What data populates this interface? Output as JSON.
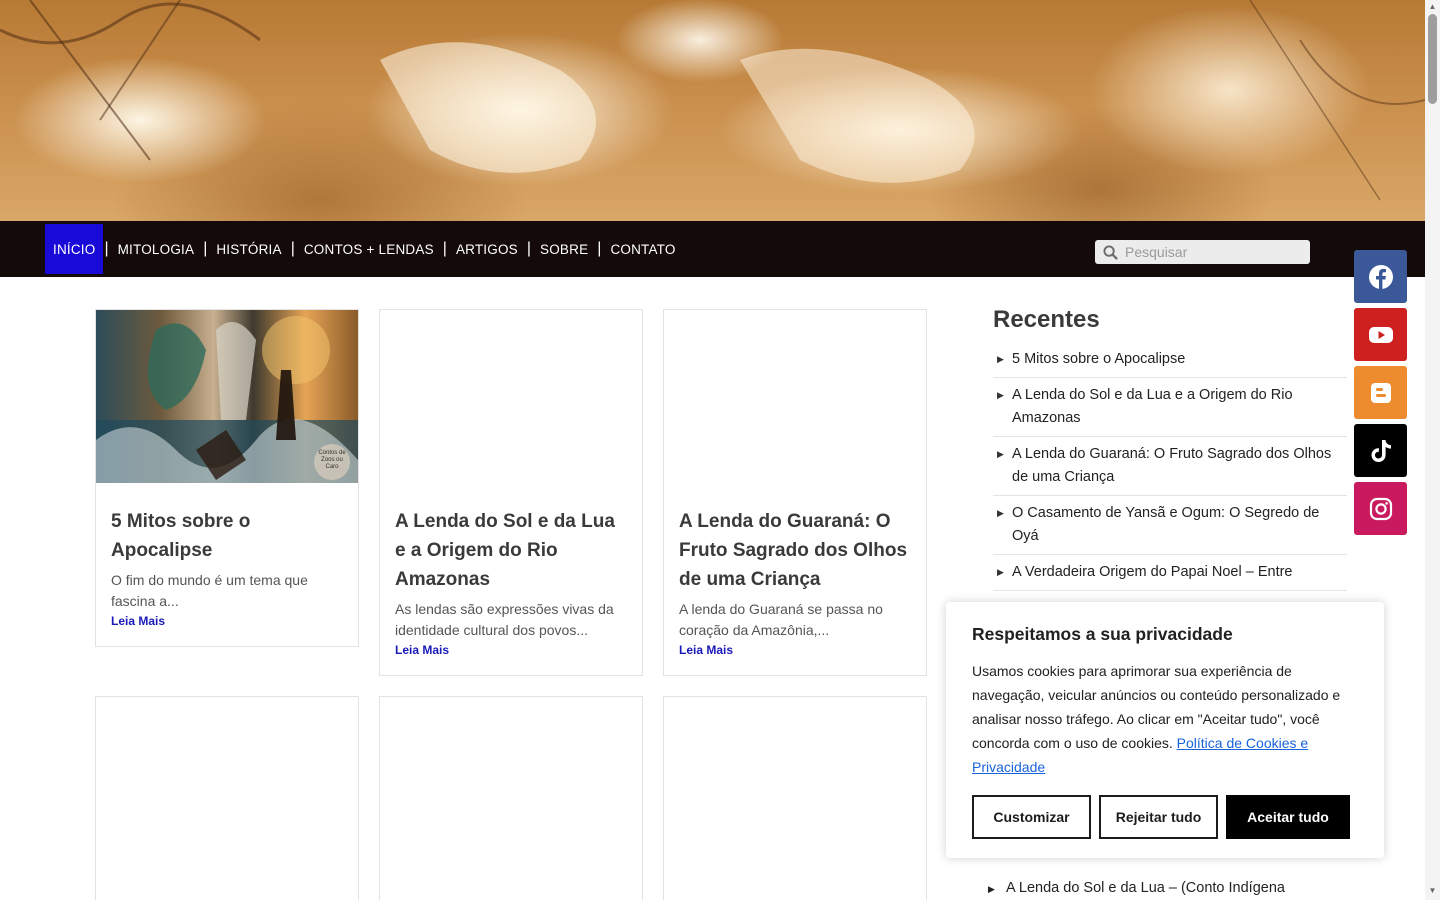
{
  "nav": {
    "items": [
      {
        "label": "INÍCIO",
        "active": true
      },
      {
        "label": "MITOLOGIA"
      },
      {
        "label": "HISTÓRIA"
      },
      {
        "label": "CONTOS + LENDAS"
      },
      {
        "label": "ARTIGOS"
      },
      {
        "label": "SOBRE"
      },
      {
        "label": "CONTATO"
      }
    ],
    "separator": "|"
  },
  "search": {
    "placeholder": "Pesquisar",
    "icon": "search-icon"
  },
  "posts": [
    {
      "title": "5 Mitos sobre o Apocalipse",
      "excerpt": "O fim do mundo é um tema que fascina a...",
      "more": "Leia Mais",
      "thumb_caption": "Contos de Zoos ou Caro"
    },
    {
      "title": "A Lenda do Sol e da Lua e a Origem do Rio Amazonas",
      "excerpt": "As lendas são expressões vivas da identidade cultural dos povos...",
      "more": "Leia Mais"
    },
    {
      "title": "A Lenda do Guaraná: O Fruto Sagrado dos Olhos de uma Criança",
      "excerpt": "A lenda do Guaraná se passa no coração da Amazônia,...",
      "more": "Leia Mais"
    }
  ],
  "sidebar": {
    "title": "Recentes",
    "items": [
      "5 Mitos sobre o Apocalipse",
      "A Lenda do Sol e da Lua e a Origem do Rio Amazonas",
      "A Lenda do Guaraná: O Fruto Sagrado dos Olhos de uma Criança",
      "O Casamento de Yansã e Ogum: O Segredo de Oyá",
      "A Verdadeira Origem do Papai Noel – Entre"
    ],
    "bottom_item": "A Lenda do Sol e da Lua – (Conto Indígena"
  },
  "social": [
    {
      "name": "facebook",
      "color": "#3b5998",
      "icon": "facebook-icon"
    },
    {
      "name": "youtube",
      "color": "#cd201f",
      "icon": "youtube-icon"
    },
    {
      "name": "blogger",
      "color": "#ec8c2e",
      "icon": "blogger-icon"
    },
    {
      "name": "tiktok",
      "color": "#000000",
      "icon": "tiktok-icon"
    },
    {
      "name": "instagram",
      "color": "#c9195f",
      "icon": "instagram-icon"
    }
  ],
  "cookie": {
    "title": "Respeitamos a sua privacidade",
    "text": "Usamos cookies para aprimorar sua experiência de navegação, veicular anúncios ou conteúdo personalizado e analisar nosso tráfego. Ao clicar em \"Aceitar tudo\", você concorda com o uso de cookies.",
    "link": "Política de Cookies e Privacidade",
    "customize": "Customizar",
    "reject": "Rejeitar tudo",
    "accept": "Aceitar tudo"
  },
  "colors": {
    "nav_bg": "#140a0a",
    "nav_active": "#1a0ad8",
    "link": "#1a1ab8",
    "cookie_link": "#1863dc"
  }
}
